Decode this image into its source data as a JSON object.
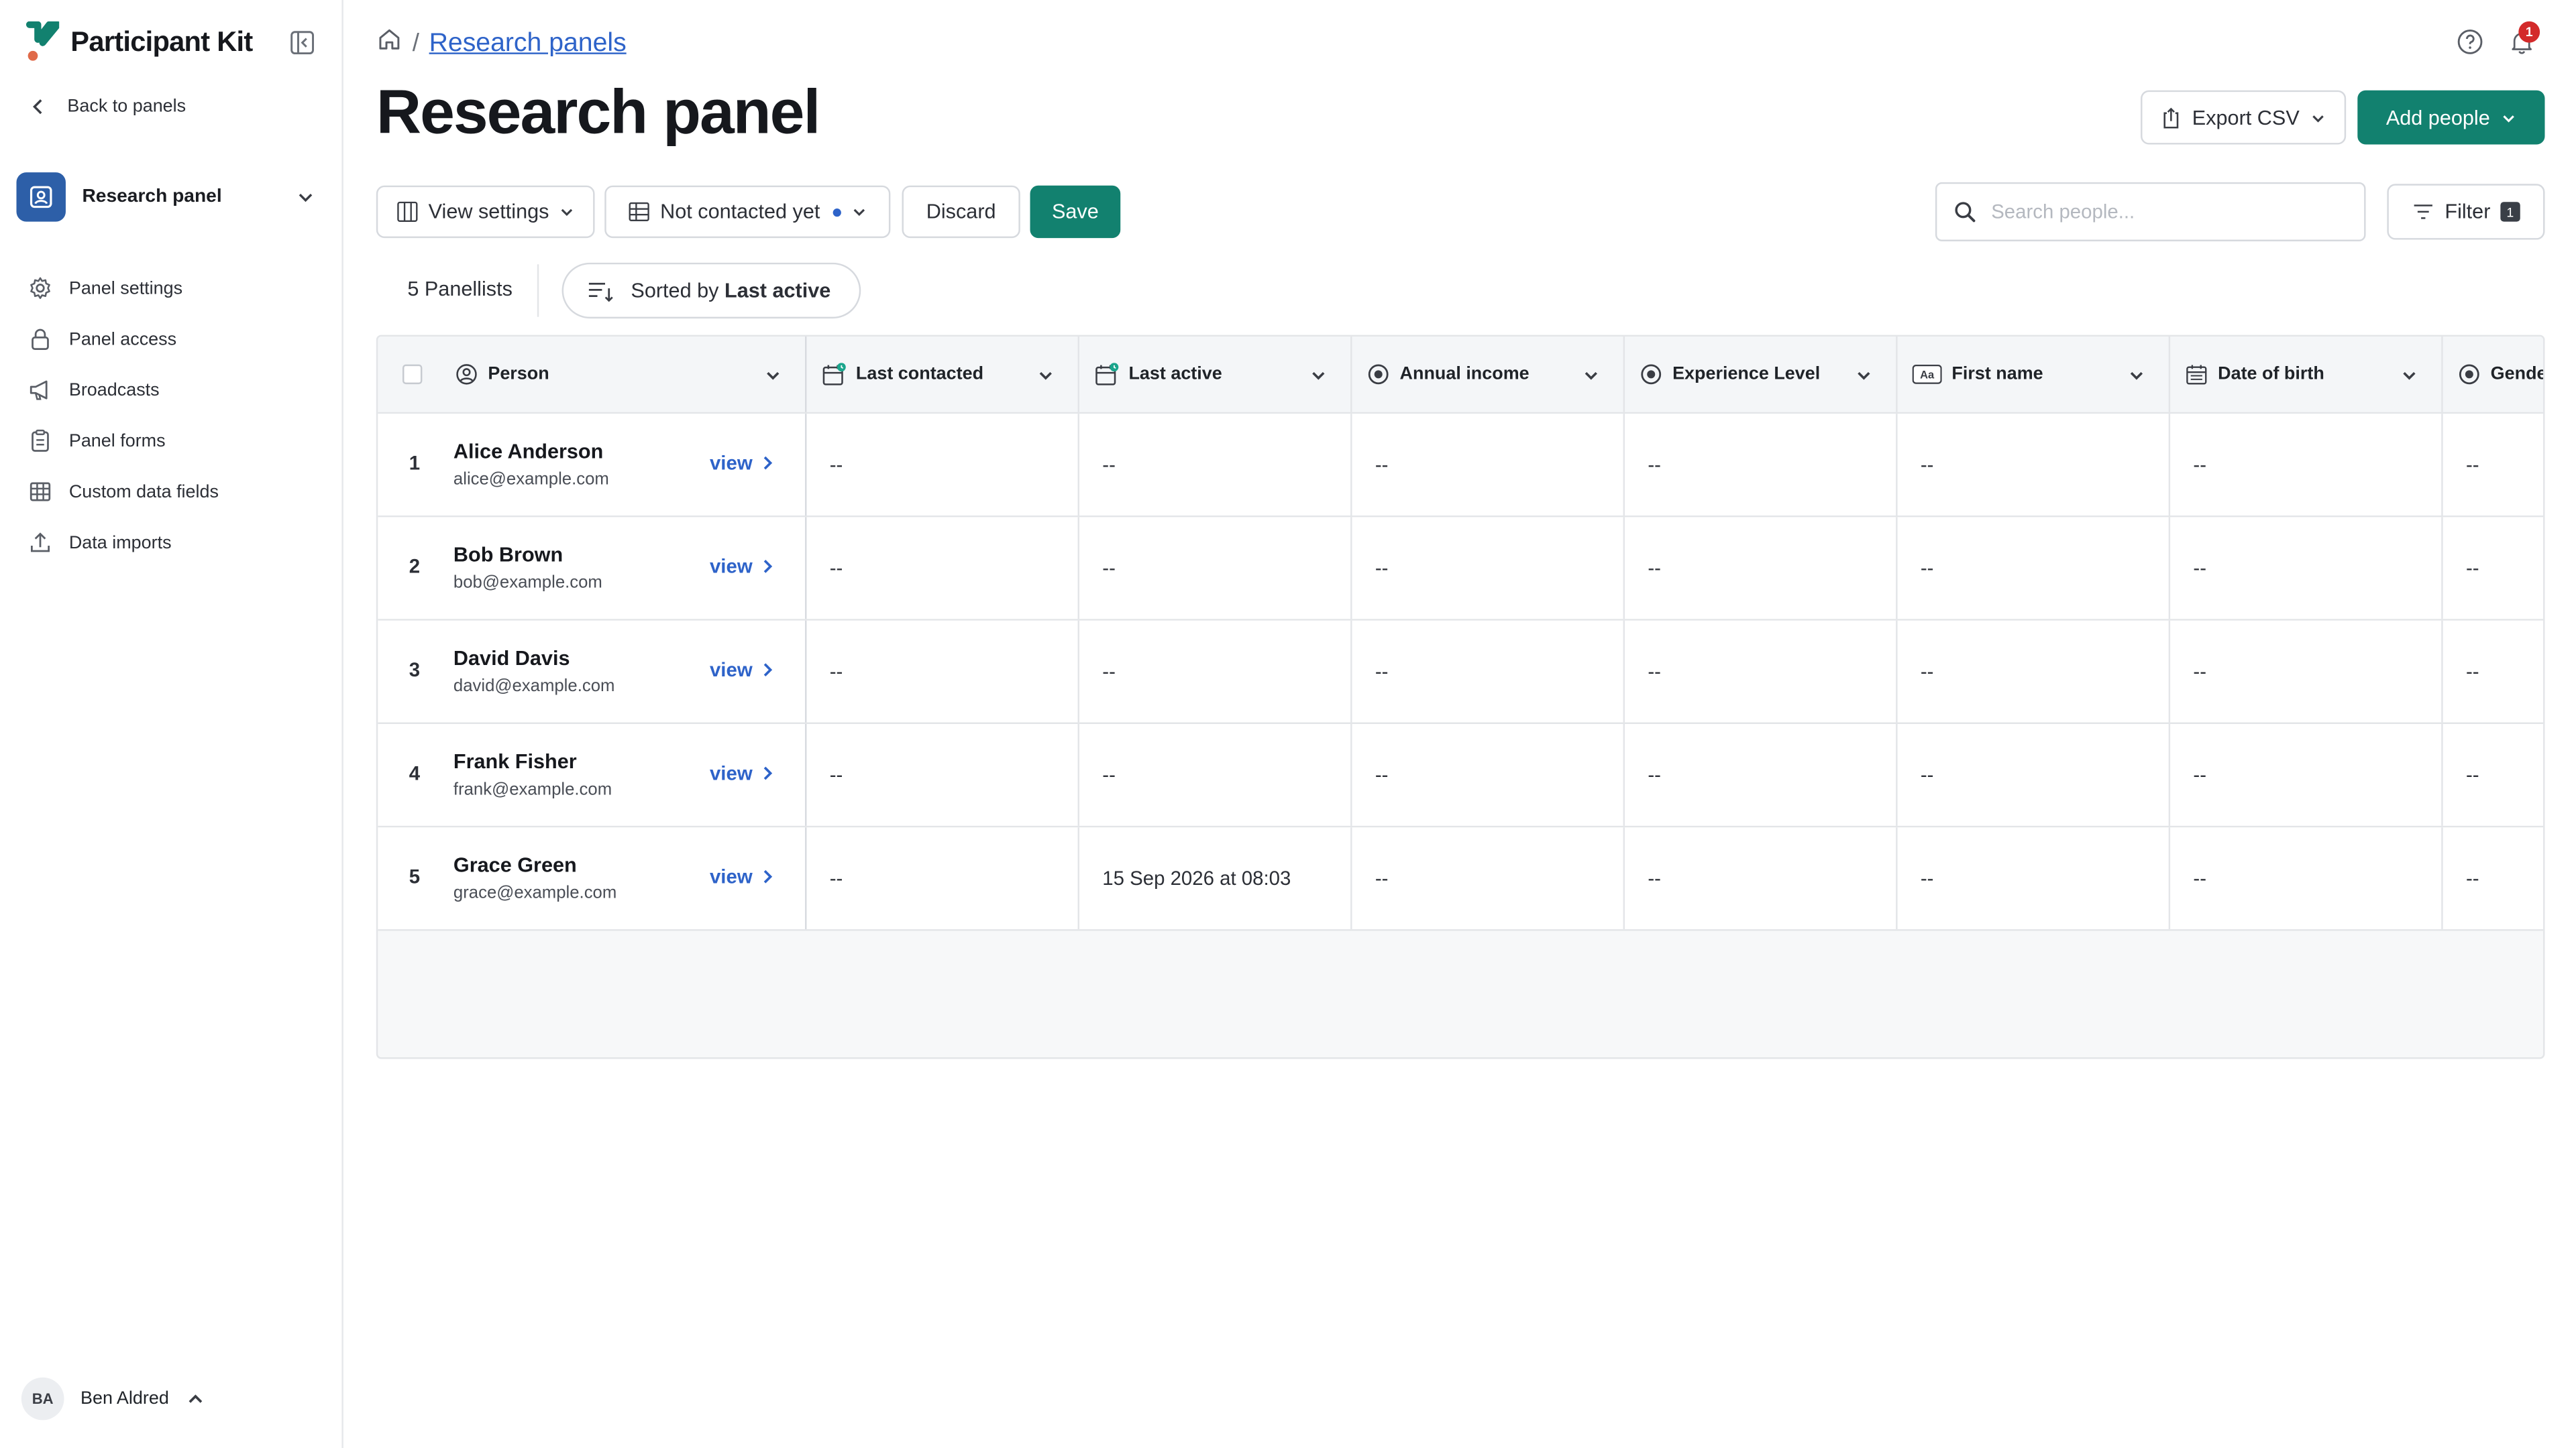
{
  "app": {
    "name": "Participant Kit"
  },
  "sidebar": {
    "back_label": "Back to panels",
    "panel_name": "Research panel",
    "items": [
      {
        "label": "Panel settings",
        "icon": "gear-icon"
      },
      {
        "label": "Panel access",
        "icon": "lock-icon"
      },
      {
        "label": "Broadcasts",
        "icon": "megaphone-icon"
      },
      {
        "label": "Panel forms",
        "icon": "clipboard-icon"
      },
      {
        "label": "Custom data fields",
        "icon": "table-icon"
      },
      {
        "label": "Data imports",
        "icon": "upload-icon"
      }
    ],
    "user": {
      "initials": "BA",
      "name": "Ben Aldred"
    }
  },
  "header": {
    "breadcrumb_sep": "/",
    "breadcrumb_link": "Research panels",
    "title": "Research panel",
    "notification_count": "1",
    "export_label": "Export CSV",
    "add_label": "Add people"
  },
  "toolbar": {
    "view_settings": "View settings",
    "view_name": "Not contacted yet",
    "discard": "Discard",
    "save": "Save",
    "search_placeholder": "Search people...",
    "filter_label": "Filter",
    "filter_count": "1"
  },
  "list": {
    "count_label": "5 Panellists",
    "sort_prefix": "Sorted by",
    "sort_field": "Last active"
  },
  "table": {
    "person_header": "Person",
    "columns": [
      "Last contacted",
      "Last active",
      "Annual income",
      "Experience Level",
      "First name",
      "Date of birth",
      "Gende"
    ],
    "view_label": "view",
    "rows": [
      {
        "num": "1",
        "name": "Alice Anderson",
        "email": "alice@example.com",
        "cells": [
          "--",
          "--",
          "--",
          "--",
          "--",
          "--",
          "--"
        ]
      },
      {
        "num": "2",
        "name": "Bob Brown",
        "email": "bob@example.com",
        "cells": [
          "--",
          "--",
          "--",
          "--",
          "--",
          "--",
          "--"
        ]
      },
      {
        "num": "3",
        "name": "David Davis",
        "email": "david@example.com",
        "cells": [
          "--",
          "--",
          "--",
          "--",
          "--",
          "--",
          "--"
        ]
      },
      {
        "num": "4",
        "name": "Frank Fisher",
        "email": "frank@example.com",
        "cells": [
          "--",
          "--",
          "--",
          "--",
          "--",
          "--",
          "--"
        ]
      },
      {
        "num": "5",
        "name": "Grace Green",
        "email": "grace@example.com",
        "cells": [
          "--",
          "15 Sep 2026 at 08:03",
          "--",
          "--",
          "--",
          "--",
          "--"
        ]
      }
    ]
  },
  "colors": {
    "primary": "#12816f",
    "link": "#2e63c9",
    "panel_icon_bg": "#2d5fa8",
    "badge": "#d32a2a"
  }
}
